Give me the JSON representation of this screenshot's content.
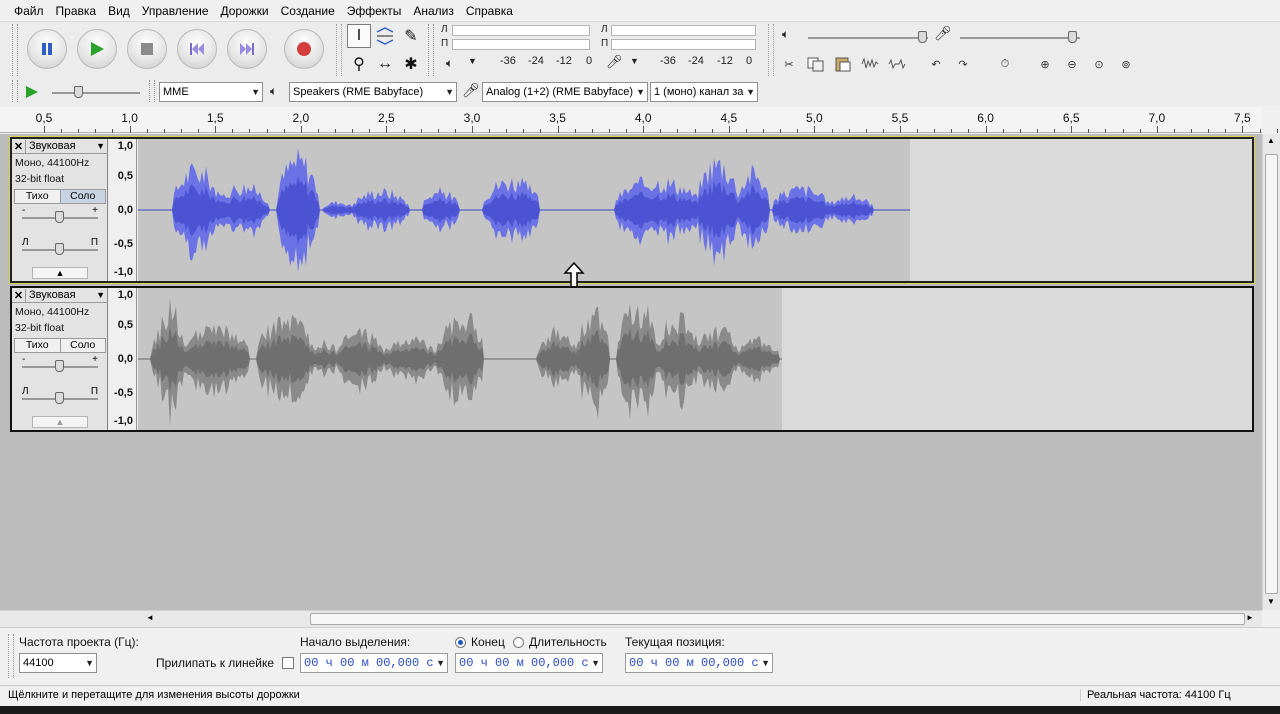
{
  "menu": [
    "Файл",
    "Правка",
    "Вид",
    "Управление",
    "Дорожки",
    "Создание",
    "Эффекты",
    "Анализ",
    "Справка"
  ],
  "transport": {
    "pause_icon": "pause-icon",
    "play_icon": "play-icon",
    "stop_icon": "stop-icon",
    "skip_start_icon": "skip-start-icon",
    "skip_end_icon": "skip-end-icon",
    "record_icon": "record-icon"
  },
  "meters": {
    "play_channel_l": "Л",
    "play_channel_r": "П",
    "rec_channel_l": "Л",
    "rec_channel_r": "П",
    "play_scale": [
      "-36",
      "-24",
      "-12",
      "0"
    ],
    "rec_scale": [
      "-36",
      "-24",
      "-12",
      "0"
    ]
  },
  "device": {
    "host": "MME",
    "output": "Speakers (RME Babyface)",
    "input": "Analog (1+2) (RME Babyface)",
    "channels": "1 (моно) канал за"
  },
  "ruler": {
    "labels": [
      "0,5",
      "1,0",
      "1,5",
      "2,0",
      "2,5",
      "3,0",
      "3,5",
      "4,0",
      "4,5",
      "5,0",
      "5,5",
      "6,0",
      "6,5",
      "7,0",
      "7,5"
    ]
  },
  "tracks": [
    {
      "name": "Звуковая",
      "format": "Моно, 44100Hz",
      "bitdepth": "32-bit float",
      "mute": "Тихо",
      "solo": "Соло",
      "gain_minus": "-",
      "gain_plus": "+",
      "pan_l": "Л",
      "pan_r": "П",
      "scale": [
        "1,0",
        "0,5",
        "0,0",
        "-0,5",
        "-1,0"
      ],
      "color": "#5a64dc"
    },
    {
      "name": "Звуковая",
      "format": "Моно, 44100Hz",
      "bitdepth": "32-bit float",
      "mute": "Тихо",
      "solo": "Соло",
      "gain_minus": "-",
      "gain_plus": "+",
      "pan_l": "Л",
      "pan_r": "П",
      "scale": [
        "1,0",
        "0,5",
        "0,0",
        "-0,5",
        "-1,0"
      ],
      "color": "#7a7a7a"
    }
  ],
  "selection": {
    "rate_label": "Частота проекта (Гц):",
    "rate_value": "44100",
    "snap_label": "Прилипать к линейке",
    "start_label": "Начало выделения:",
    "end_label": "Конец",
    "length_label": "Длительность",
    "position_label": "Текущая позиция:",
    "start_time": "00 ч 00 м 00,000 с",
    "end_time": "00 ч 00 м 00,000 с",
    "position_time": "00 ч 00 м 00,000 с"
  },
  "status": {
    "hint": "Щёлкните и перетащите для изменения высоты дорожки",
    "rate": "Реальная частота: 44100 Гц"
  }
}
